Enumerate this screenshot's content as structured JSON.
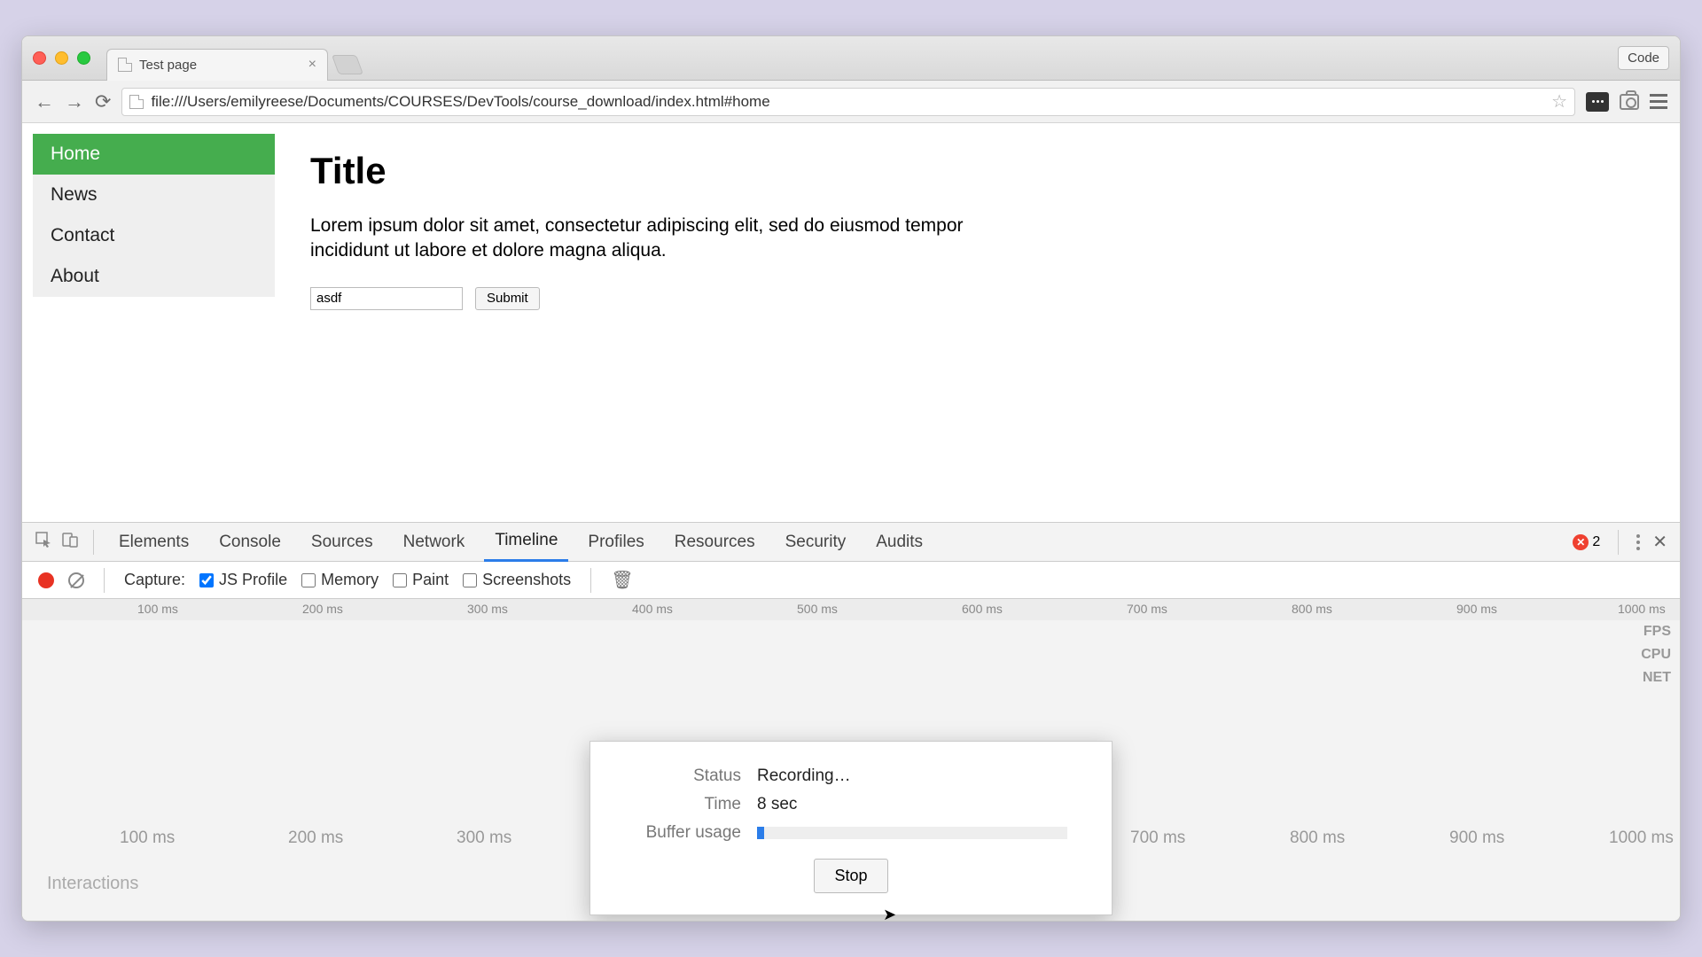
{
  "window": {
    "tab_title": "Test page",
    "code_button": "Code",
    "url": "file:///Users/emilyreese/Documents/COURSES/DevTools/course_download/index.html#home"
  },
  "sidebar": {
    "items": [
      {
        "label": "Home",
        "active": true
      },
      {
        "label": "News",
        "active": false
      },
      {
        "label": "Contact",
        "active": false
      },
      {
        "label": "About",
        "active": false
      }
    ]
  },
  "page": {
    "title": "Title",
    "paragraph": "Lorem ipsum dolor sit amet, consectetur adipiscing elit, sed do eiusmod tempor incididunt ut labore et dolore magna aliqua.",
    "input_value": "asdf",
    "submit_label": "Submit"
  },
  "devtools": {
    "tabs": [
      "Elements",
      "Console",
      "Sources",
      "Network",
      "Timeline",
      "Profiles",
      "Resources",
      "Security",
      "Audits"
    ],
    "active_tab": "Timeline",
    "error_count": "2",
    "toolbar": {
      "capture_label": "Capture:",
      "js_profile": "JS Profile",
      "memory": "Memory",
      "paint": "Paint",
      "screenshots": "Screenshots",
      "js_profile_checked": true,
      "memory_checked": false,
      "paint_checked": false,
      "screenshots_checked": false
    },
    "ruler_ticks": [
      "100 ms",
      "200 ms",
      "300 ms",
      "400 ms",
      "500 ms",
      "600 ms",
      "700 ms",
      "800 ms",
      "900 ms",
      "1000 ms"
    ],
    "lanes": [
      "FPS",
      "CPU",
      "NET"
    ],
    "interactions_label": "Interactions"
  },
  "modal": {
    "status_label": "Status",
    "status_value": "Recording…",
    "time_label": "Time",
    "time_value": "8 sec",
    "buffer_label": "Buffer usage",
    "buffer_percent": 3,
    "stop_label": "Stop"
  }
}
